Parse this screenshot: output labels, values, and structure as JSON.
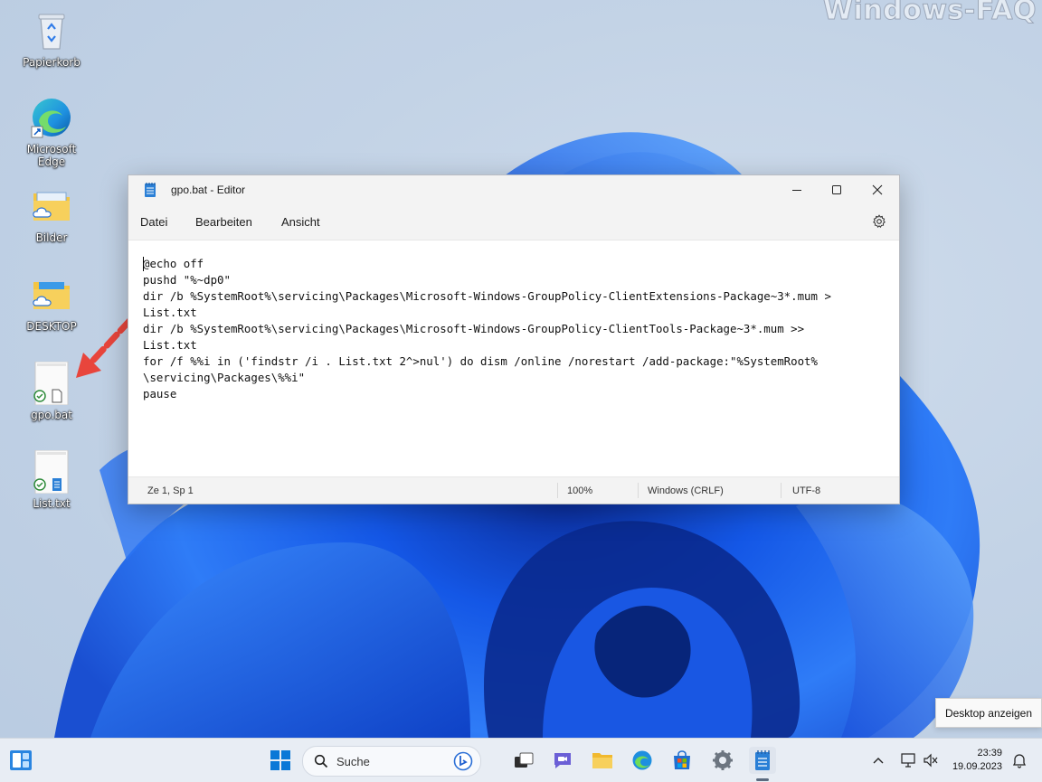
{
  "watermark": "Windows-FAQ",
  "desktop": {
    "icons": [
      {
        "label": "Papierkorb",
        "icon": "recycle-bin-icon"
      },
      {
        "label": "Microsoft Edge",
        "icon": "edge-icon"
      },
      {
        "label": "Bilder",
        "icon": "folder-icon"
      },
      {
        "label": "DESKTOP",
        "icon": "folder-icon"
      },
      {
        "label": "gpo.bat",
        "icon": "batch-file-icon"
      },
      {
        "label": "List.txt",
        "icon": "text-file-icon"
      }
    ]
  },
  "notepad": {
    "title": "gpo.bat - Editor",
    "menu": [
      "Datei",
      "Bearbeiten",
      "Ansicht"
    ],
    "content": "@echo off\npushd \"%~dp0\"\ndir /b %SystemRoot%\\servicing\\Packages\\Microsoft-Windows-GroupPolicy-ClientExtensions-Package~3*.mum >\nList.txt\ndir /b %SystemRoot%\\servicing\\Packages\\Microsoft-Windows-GroupPolicy-ClientTools-Package~3*.mum >>\nList.txt\nfor /f %%i in ('findstr /i . List.txt 2^>nul') do dism /online /norestart /add-package:\"%SystemRoot%\n\\servicing\\Packages\\%%i\"\npause",
    "status": {
      "position": "Ze 1, Sp 1",
      "zoom": "100%",
      "line_ending": "Windows (CRLF)",
      "encoding": "UTF-8"
    }
  },
  "tooltip": "Desktop anzeigen",
  "taskbar": {
    "search_label": "Suche",
    "time": "23:39",
    "date": "19.09.2023"
  },
  "colors": {
    "accent": "#0067c0",
    "annotation_arrow": "#e8453c",
    "folder": "#f4c542"
  }
}
